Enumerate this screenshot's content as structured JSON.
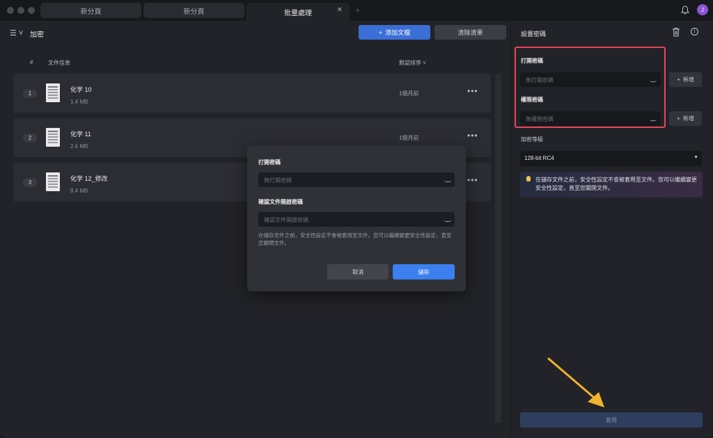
{
  "tabs": [
    {
      "label": "新分頁"
    },
    {
      "label": "新分頁"
    },
    {
      "label": "批量處理"
    }
  ],
  "user": {
    "initial": "J"
  },
  "main": {
    "title": "加密",
    "add_button": "添加文檔",
    "clear_button": "清除清單",
    "columns": {
      "index": "#",
      "info": "文件信息",
      "sort": "默認排序"
    },
    "files": [
      {
        "index": "1",
        "name": "化学 10",
        "size": "1.4 MB",
        "time": "1個月前"
      },
      {
        "index": "2",
        "name": "化学 11",
        "size": "2.6 MB",
        "time": "1個月前"
      },
      {
        "index": "3",
        "name": "化学 12_修改",
        "size": "8.4 MB",
        "time": ""
      }
    ]
  },
  "right_panel": {
    "title": "設置密碼",
    "open_password_label": "打開密碼",
    "open_password_placeholder": "無打開密碼",
    "permission_password_label": "權限密碼",
    "permission_password_placeholder": "無權限密碼",
    "new_button": "新增",
    "level_label": "加密等級",
    "level_value": "128-bit RC4",
    "tip": "在儲存文件之前，安全性設定不會被套用至文件。您可以繼續變更安全性設定，直至您關閉文件。",
    "apply_button": "套用"
  },
  "modal": {
    "open_password_label": "打開密碼",
    "open_password_placeholder": "無打開密碼",
    "confirm_label": "確認文件開啟密碼",
    "confirm_placeholder": "確認文件開啟密碼",
    "note": "在儲存文件之前，安全性設定不會被套用至文件。您可以繼續變更安全性設定，直至您關閉文件。",
    "cancel_button": "取消",
    "save_button": "儲存"
  },
  "colors": {
    "accent": "#3b7ff0",
    "highlight": "#e8455a",
    "arrow": "#f2b42c"
  }
}
